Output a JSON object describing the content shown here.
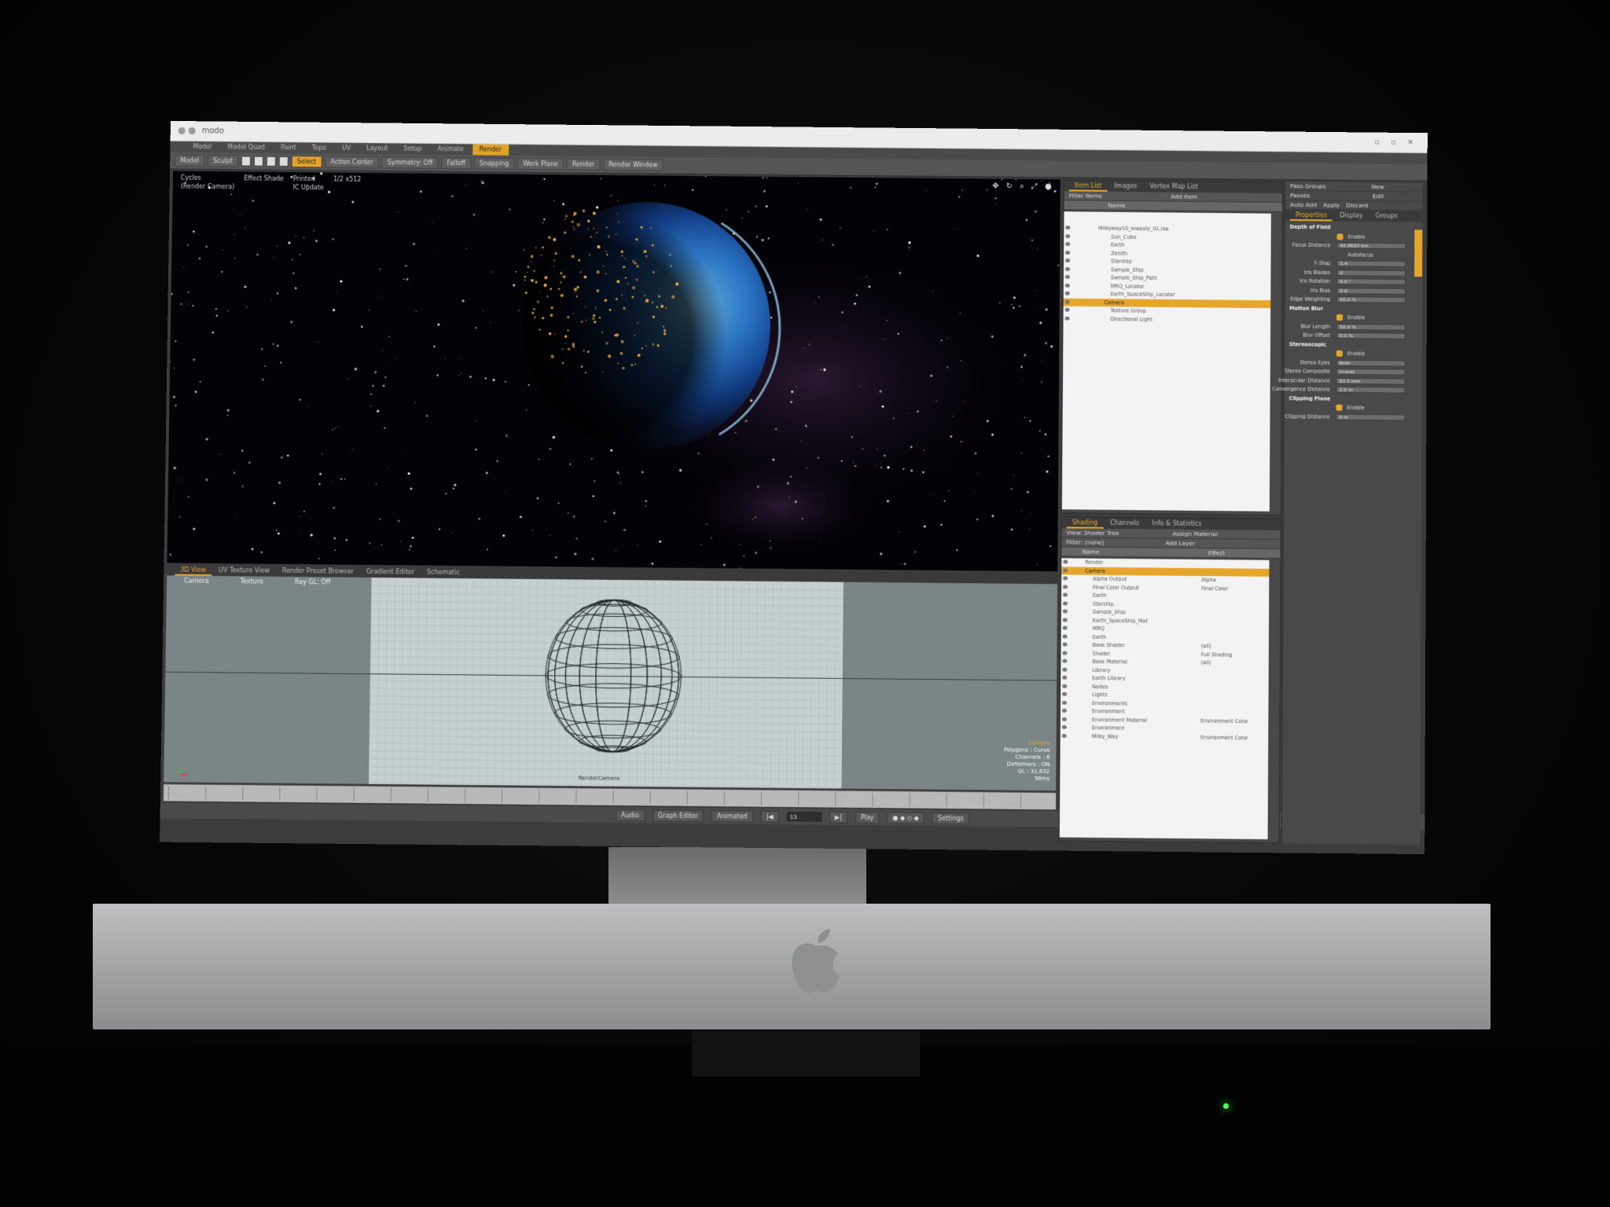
{
  "window": {
    "title": "modo"
  },
  "layout_tabs": [
    "Model",
    "Model Quad",
    "Paint",
    "Topo",
    "UV",
    "Layout",
    "Setup",
    "Animate",
    "Render"
  ],
  "active_layout_tab": 8,
  "toolbar": {
    "mode_model": "Model",
    "mode_sculpt": "Sculpt",
    "select_label": "Select",
    "action_center": "Action Center",
    "symmetry": "Symmetry: Off",
    "falloff": "Falloff",
    "snapping": "Snapping",
    "work_plane": "Work Plane",
    "render": "Render",
    "render_window": "Render Window"
  },
  "render_viewport": {
    "opt1": "Cycles",
    "opt2": "Effect Shade",
    "opt3": "Printed",
    "opt4": "1/2 x512",
    "opt5": "(Render Camera)",
    "opt6": "IC Update",
    "nav_icons": "✥ ↻ ⌕ ⤢ ●"
  },
  "bottom_tabs": [
    "3D View",
    "UV Texture View",
    "Render Preset Browser",
    "Gradient Editor",
    "Schematic"
  ],
  "view3d": {
    "opt_camera": "Camera",
    "opt_texture": "Texture",
    "opt_gl": "Ray GL: Off",
    "camera_label": "RenderCamera",
    "info_title": "Camera",
    "info_lines": [
      "Polygons : Curve",
      "Channels : 6",
      "Deformers : ON",
      "GL : 31,632",
      "56ms"
    ]
  },
  "transport": {
    "audio": "Audio",
    "graph_editor": "Graph Editor",
    "animated": "Animated",
    "frame": "13",
    "play": "Play",
    "settings": "Settings"
  },
  "item_list": {
    "tabs": [
      "Item List",
      "Images",
      "Vertex Map List"
    ],
    "filter": "Filter Items",
    "add_item": "Add Item",
    "col_name": "Name",
    "items": [
      {
        "name": "Milkyway10_lowpoly_GL.lxo",
        "indent": 0,
        "sel": false
      },
      {
        "name": "Sun_Cube",
        "indent": 2,
        "sel": false
      },
      {
        "name": "Earth",
        "indent": 2,
        "sel": false
      },
      {
        "name": "Zenith",
        "indent": 2,
        "sel": false
      },
      {
        "name": "Starship",
        "indent": 2,
        "sel": false
      },
      {
        "name": "Sample_Ship",
        "indent": 2,
        "sel": false
      },
      {
        "name": "Sample_Ship_Path",
        "indent": 2,
        "sel": false
      },
      {
        "name": "MRQ_Locator",
        "indent": 2,
        "sel": false
      },
      {
        "name": "Earth_SpaceShip_Locator",
        "indent": 2,
        "sel": false
      },
      {
        "name": "Camera",
        "indent": 1,
        "sel": true
      },
      {
        "name": "Texture Group",
        "indent": 2,
        "sel": false
      },
      {
        "name": "Directional Light",
        "indent": 2,
        "sel": false
      }
    ]
  },
  "shading": {
    "tabs": [
      "Shading",
      "Channels",
      "Info & Statistics"
    ],
    "view": "View: Shader Tree",
    "assign": "Assign Material",
    "filter": "Filter: (none)",
    "add_layer": "Add Layer",
    "col_name": "Name",
    "col_effect": "Effect",
    "rows": [
      {
        "name": "Render",
        "effect": "",
        "sel": false
      },
      {
        "name": "Camera",
        "effect": "",
        "sel": true
      },
      {
        "name": "Alpha Output",
        "effect": "Alpha",
        "sel": false
      },
      {
        "name": "Final Color Output",
        "effect": "Final Color",
        "sel": false
      },
      {
        "name": "Earth",
        "effect": "",
        "sel": false
      },
      {
        "name": "Starship",
        "effect": "",
        "sel": false
      },
      {
        "name": "Sample_Ship",
        "effect": "",
        "sel": false
      },
      {
        "name": "Earth_SpaceShip_Mat",
        "effect": "",
        "sel": false
      },
      {
        "name": "MRQ",
        "effect": "",
        "sel": false
      },
      {
        "name": "Earth",
        "effect": "",
        "sel": false
      },
      {
        "name": "Base Shader",
        "effect": "(all)",
        "sel": false
      },
      {
        "name": "Shader",
        "effect": "Full Shading",
        "sel": false
      },
      {
        "name": "Base Material",
        "effect": "(all)",
        "sel": false
      },
      {
        "name": "Library",
        "effect": "",
        "sel": false
      },
      {
        "name": "Earth Library",
        "effect": "",
        "sel": false
      },
      {
        "name": "Nodes",
        "effect": "",
        "sel": false
      },
      {
        "name": "Lights",
        "effect": "",
        "sel": false
      },
      {
        "name": "Environments",
        "effect": "",
        "sel": false
      },
      {
        "name": "Environment",
        "effect": "",
        "sel": false
      },
      {
        "name": "Environment Material",
        "effect": "Environment Color",
        "sel": false
      },
      {
        "name": "Environment",
        "effect": "",
        "sel": false
      },
      {
        "name": "Milky_Way",
        "effect": "Environment Color",
        "sel": false
      }
    ]
  },
  "properties": {
    "pass_groups": "Pass Groups",
    "passes": "Passes",
    "new": "New",
    "edit": "Edit",
    "auto_add": "Auto Add",
    "apply": "Apply",
    "discard": "Discard",
    "tabs": [
      "Properties",
      "Display",
      "Groups"
    ],
    "rows": [
      {
        "type": "section",
        "label": "Depth of Field"
      },
      {
        "type": "check",
        "label": "",
        "value": "Enable"
      },
      {
        "type": "field",
        "label": "Focus Distance",
        "value": "42.9693 km"
      },
      {
        "type": "sub",
        "label": "",
        "value": "Autofocus"
      },
      {
        "type": "field",
        "label": "F-Stop",
        "value": "1.4"
      },
      {
        "type": "field",
        "label": "Iris Blades",
        "value": "0"
      },
      {
        "type": "field",
        "label": "Iris Rotation",
        "value": "0.0 °"
      },
      {
        "type": "field",
        "label": "Iris Bias",
        "value": "0.0"
      },
      {
        "type": "field",
        "label": "Edge Weighting",
        "value": "50.0 %"
      },
      {
        "type": "section",
        "label": "Motion Blur"
      },
      {
        "type": "check",
        "label": "",
        "value": "Enable"
      },
      {
        "type": "field",
        "label": "Blur Length",
        "value": "50.0 %"
      },
      {
        "type": "field",
        "label": "Blur Offset",
        "value": "0.0 %"
      },
      {
        "type": "section",
        "label": "Stereoscopic"
      },
      {
        "type": "check",
        "label": "",
        "value": "Enable"
      },
      {
        "type": "field",
        "label": "Stereo Eyes",
        "value": "Both"
      },
      {
        "type": "field",
        "label": "Stereo Composite",
        "value": "(none)"
      },
      {
        "type": "field",
        "label": "Interocular Distance",
        "value": "63.5 mm"
      },
      {
        "type": "field",
        "label": "Convergence Distance",
        "value": "2.0 m"
      },
      {
        "type": "section",
        "label": "Clipping Plane"
      },
      {
        "type": "check",
        "label": "",
        "value": "Enable"
      },
      {
        "type": "field",
        "label": "Clipping Distance",
        "value": "0 m"
      }
    ]
  }
}
